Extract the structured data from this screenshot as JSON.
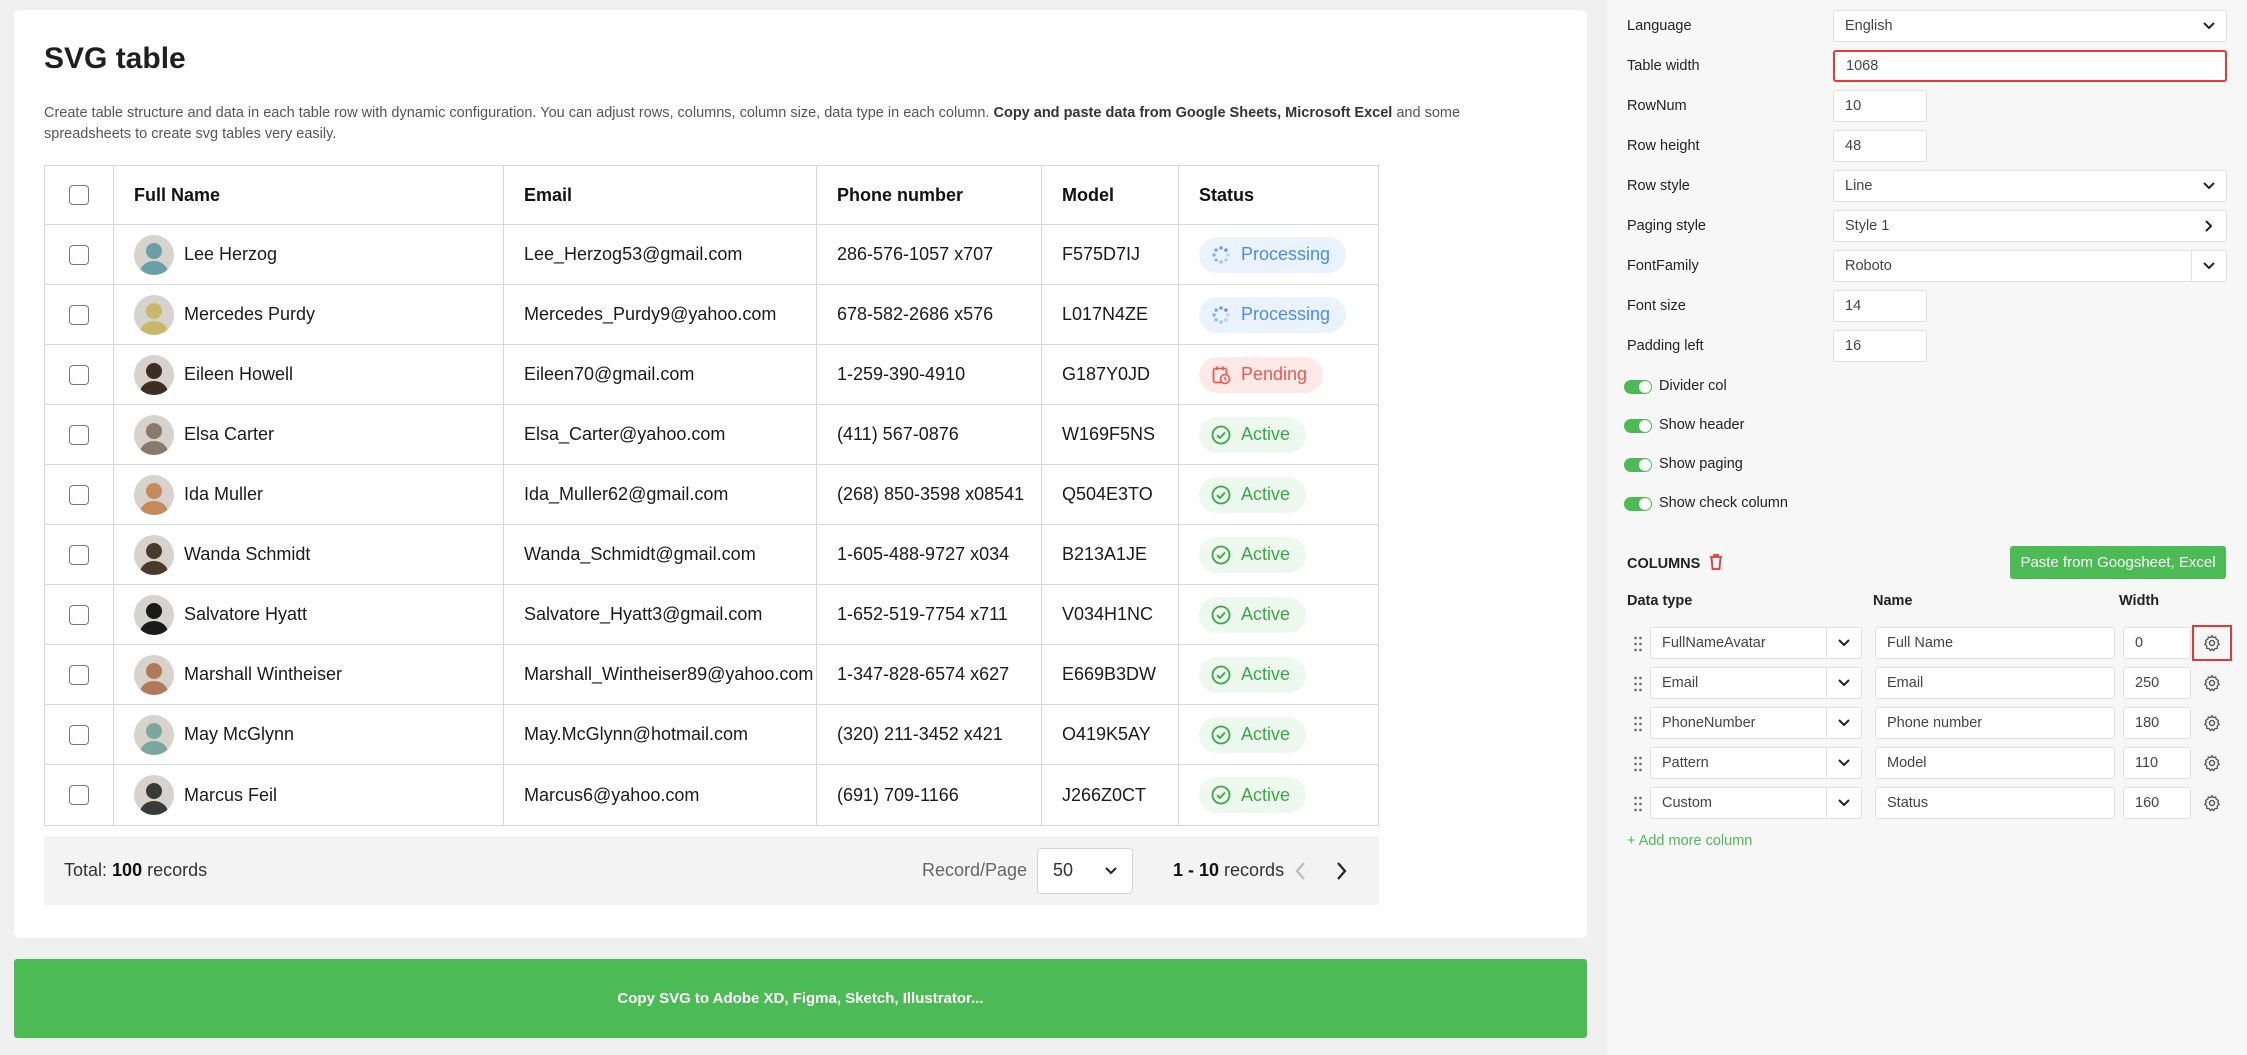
{
  "page": {
    "title": "SVG table",
    "desc_plain": "Create table structure and data in each table row with dynamic configuration. You can adjust rows, columns, column size, data type in each column.",
    "desc_bold": "Copy and paste data from Google Sheets, Microsoft Excel",
    "desc_tail": "and some spreadsheets to create svg tables very easily."
  },
  "table": {
    "headers": [
      "Full Name",
      "Email",
      "Phone number",
      "Model",
      "Status"
    ],
    "rows": [
      {
        "name": "Lee Herzog",
        "email": "Lee_Herzog53@gmail.com",
        "phone": "286-576-1057 x707",
        "model": "F575D7IJ",
        "status": "Processing",
        "avatar_color": "#6a9fa8"
      },
      {
        "name": "Mercedes Purdy",
        "email": "Mercedes_Purdy9@yahoo.com",
        "phone": "678-582-2686 x576",
        "model": "L017N4ZE",
        "status": "Processing",
        "avatar_color": "#c9b86a"
      },
      {
        "name": "Eileen Howell",
        "email": "Eileen70@gmail.com",
        "phone": "1-259-390-4910",
        "model": "G187Y0JD",
        "status": "Pending",
        "avatar_color": "#3d2d22"
      },
      {
        "name": "Elsa Carter",
        "email": "Elsa_Carter@yahoo.com",
        "phone": "(411) 567-0876",
        "model": "W169F5NS",
        "status": "Active",
        "avatar_color": "#8a7a6e"
      },
      {
        "name": "Ida Muller",
        "email": "Ida_Muller62@gmail.com",
        "phone": "(268) 850-3598 x08541",
        "model": "Q504E3TO",
        "status": "Active",
        "avatar_color": "#c48a5a"
      },
      {
        "name": "Wanda Schmidt",
        "email": "Wanda_Schmidt@gmail.com",
        "phone": "1-605-488-9727 x034",
        "model": "B213A1JE",
        "status": "Active",
        "avatar_color": "#4a3a2a"
      },
      {
        "name": "Salvatore Hyatt",
        "email": "Salvatore_Hyatt3@gmail.com",
        "phone": "1-652-519-7754 x711",
        "model": "V034H1NC",
        "status": "Active",
        "avatar_color": "#1a1a1a"
      },
      {
        "name": "Marshall Wintheiser",
        "email": "Marshall_Wintheiser89@yahoo.com",
        "phone": "1-347-828-6574 x627",
        "model": "E669B3DW",
        "status": "Active",
        "avatar_color": "#b07a5a"
      },
      {
        "name": "May McGlynn",
        "email": "May.McGlynn@hotmail.com",
        "phone": "(320) 211-3452 x421",
        "model": "O419K5AY",
        "status": "Active",
        "avatar_color": "#7aa8a0"
      },
      {
        "name": "Marcus Feil",
        "email": "Marcus6@yahoo.com",
        "phone": "(691) 709-1166",
        "model": "J266Z0CT",
        "status": "Active",
        "avatar_color": "#3a3a3a"
      }
    ]
  },
  "footer": {
    "total_label": "Total:",
    "total_count": "100",
    "total_suffix": "records",
    "rpp_label": "Record/Page",
    "rpp_value": "50",
    "range": "1 - 10",
    "range_suffix": "records"
  },
  "copy_button": "Copy SVG to Adobe XD, Figma, Sketch, Illustrator...",
  "settings": {
    "language_label": "Language",
    "language_value": "English",
    "width_label": "Table width",
    "width_value": "1068",
    "rownum_label": "RowNum",
    "rownum_value": "10",
    "rowheight_label": "Row height",
    "rowheight_value": "48",
    "rowstyle_label": "Row style",
    "rowstyle_value": "Line",
    "paging_label": "Paging style",
    "paging_value": "Style 1",
    "font_label": "FontFamily",
    "font_value": "Roboto",
    "fontsize_label": "Font size",
    "fontsize_value": "14",
    "padding_label": "Padding left",
    "padding_value": "16",
    "toggles": [
      "Divider col",
      "Show header",
      "Show paging",
      "Show check column"
    ]
  },
  "columns": {
    "title": "COLUMNS",
    "paste_button": "Paste from Googsheet, Excel",
    "hdr_type": "Data type",
    "hdr_name": "Name",
    "hdr_width": "Width",
    "items": [
      {
        "type": "FullNameAvatar",
        "name": "Full Name",
        "width": "0"
      },
      {
        "type": "Email",
        "name": "Email",
        "width": "250"
      },
      {
        "type": "PhoneNumber",
        "name": "Phone number",
        "width": "180"
      },
      {
        "type": "Pattern",
        "name": "Model",
        "width": "110"
      },
      {
        "type": "Custom",
        "name": "Status",
        "width": "160"
      }
    ],
    "add_more": "+ Add more column"
  },
  "colors": {
    "accent": "#4cbb55",
    "highlight": "#e53935",
    "processing": "#4a8ee8",
    "pending": "#e85a4f",
    "active": "#3aa944"
  }
}
